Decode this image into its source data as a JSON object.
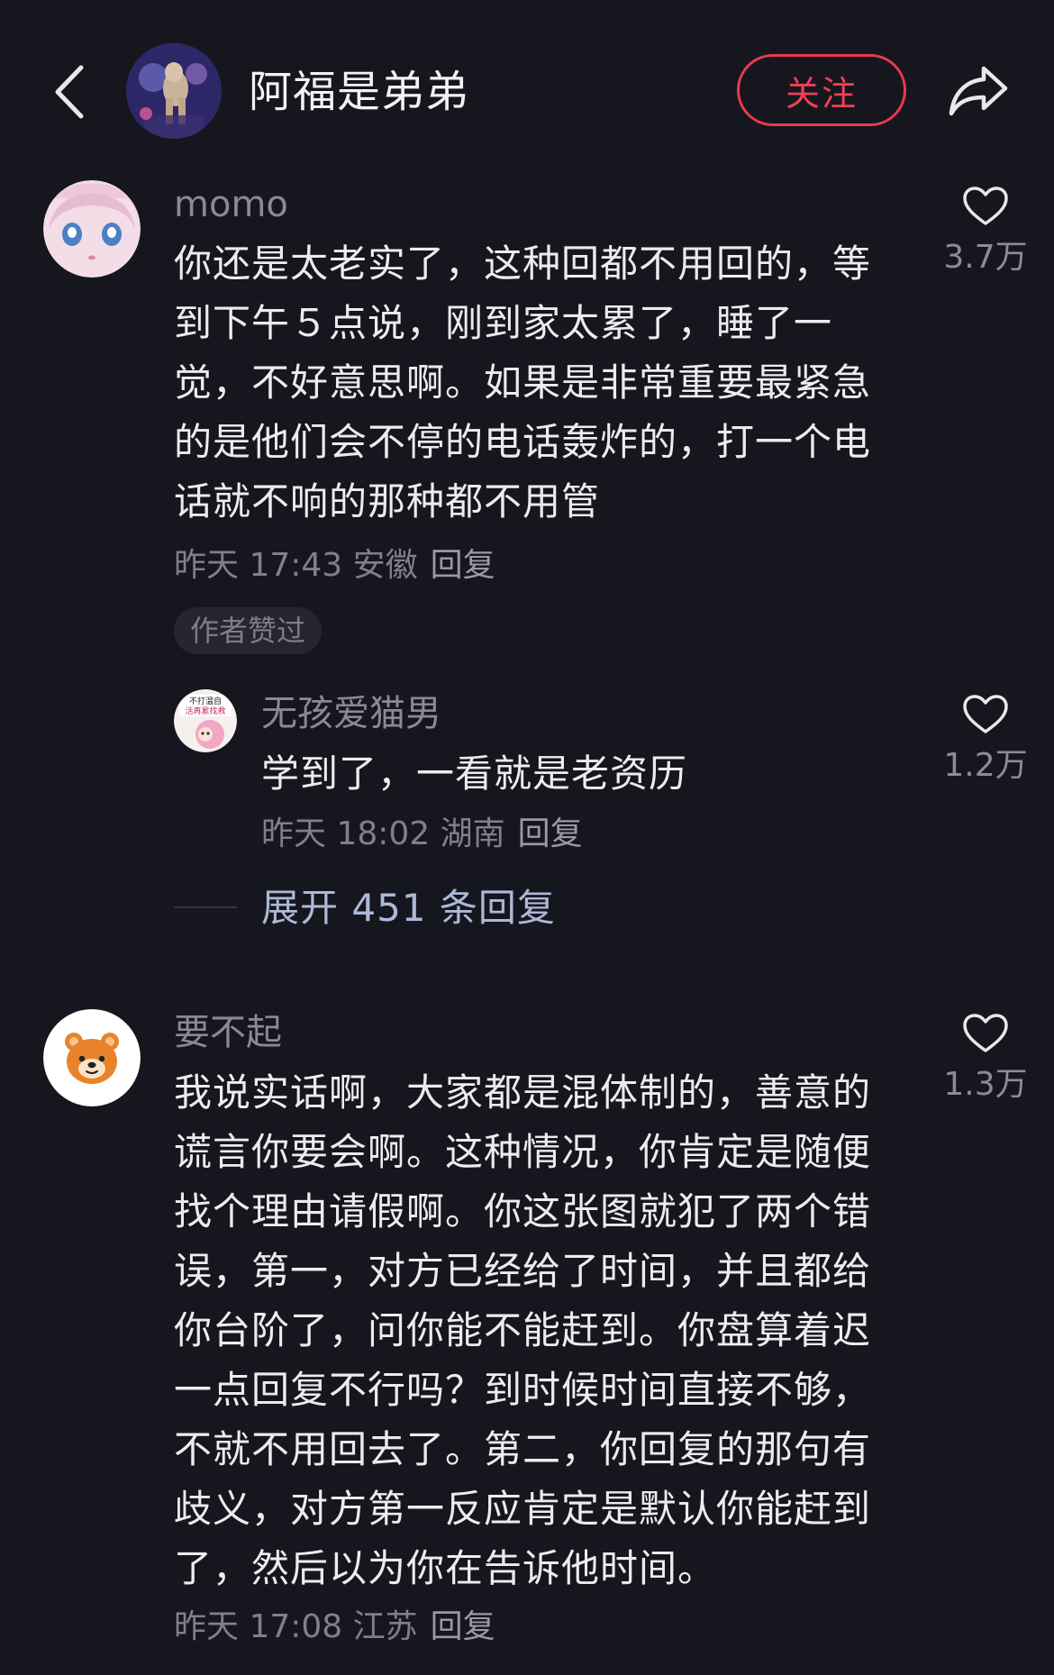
{
  "header": {
    "title": "阿福是弟弟",
    "follow_label": "关注"
  },
  "comments": [
    {
      "username": "momo",
      "text": "你还是太老实了，这种回都不用回的，等到下午５点说，刚到家太累了，睡了一觉，不好意思啊。如果是非常重要最紧急的是他们会不停的电话轰炸的，打一个电话就不响的那种都不用管",
      "time": "昨天 17:43 安徽",
      "reply_label": "回复",
      "likes": "3.7万",
      "badge": "作者赞过"
    },
    {
      "username": "无孩爱猫男",
      "text": "学到了，一看就是老资历",
      "time": "昨天 18:02 湖南",
      "reply_label": "回复",
      "likes": "1.2万",
      "avatar_text": "不打温自 活再累找救"
    },
    {
      "expand_label": "展开 451 条回复"
    },
    {
      "username": "要不起",
      "text": "我说实话啊，大家都是混体制的，善意的谎言你要会啊。这种情况，你肯定是随便找个理由请假啊。你这张图就犯了两个错误，第一，对方已经给了时间，并且都给你台阶了，问你能不能赶到。你盘算着迟一点回复不行吗？到时候时间直接不够，不就不用回去了。第二，你回复的那句有歧义，对方第一反应肯定是默认你能赶到了，然后以为你在告诉他时间。",
      "time": "昨天 17:08 江苏",
      "reply_label": "回复",
      "likes": "1.3万"
    }
  ],
  "colors": {
    "background": "#16161e",
    "follow_accent": "#e83a4e",
    "expand_link": "#aeb8d8"
  }
}
